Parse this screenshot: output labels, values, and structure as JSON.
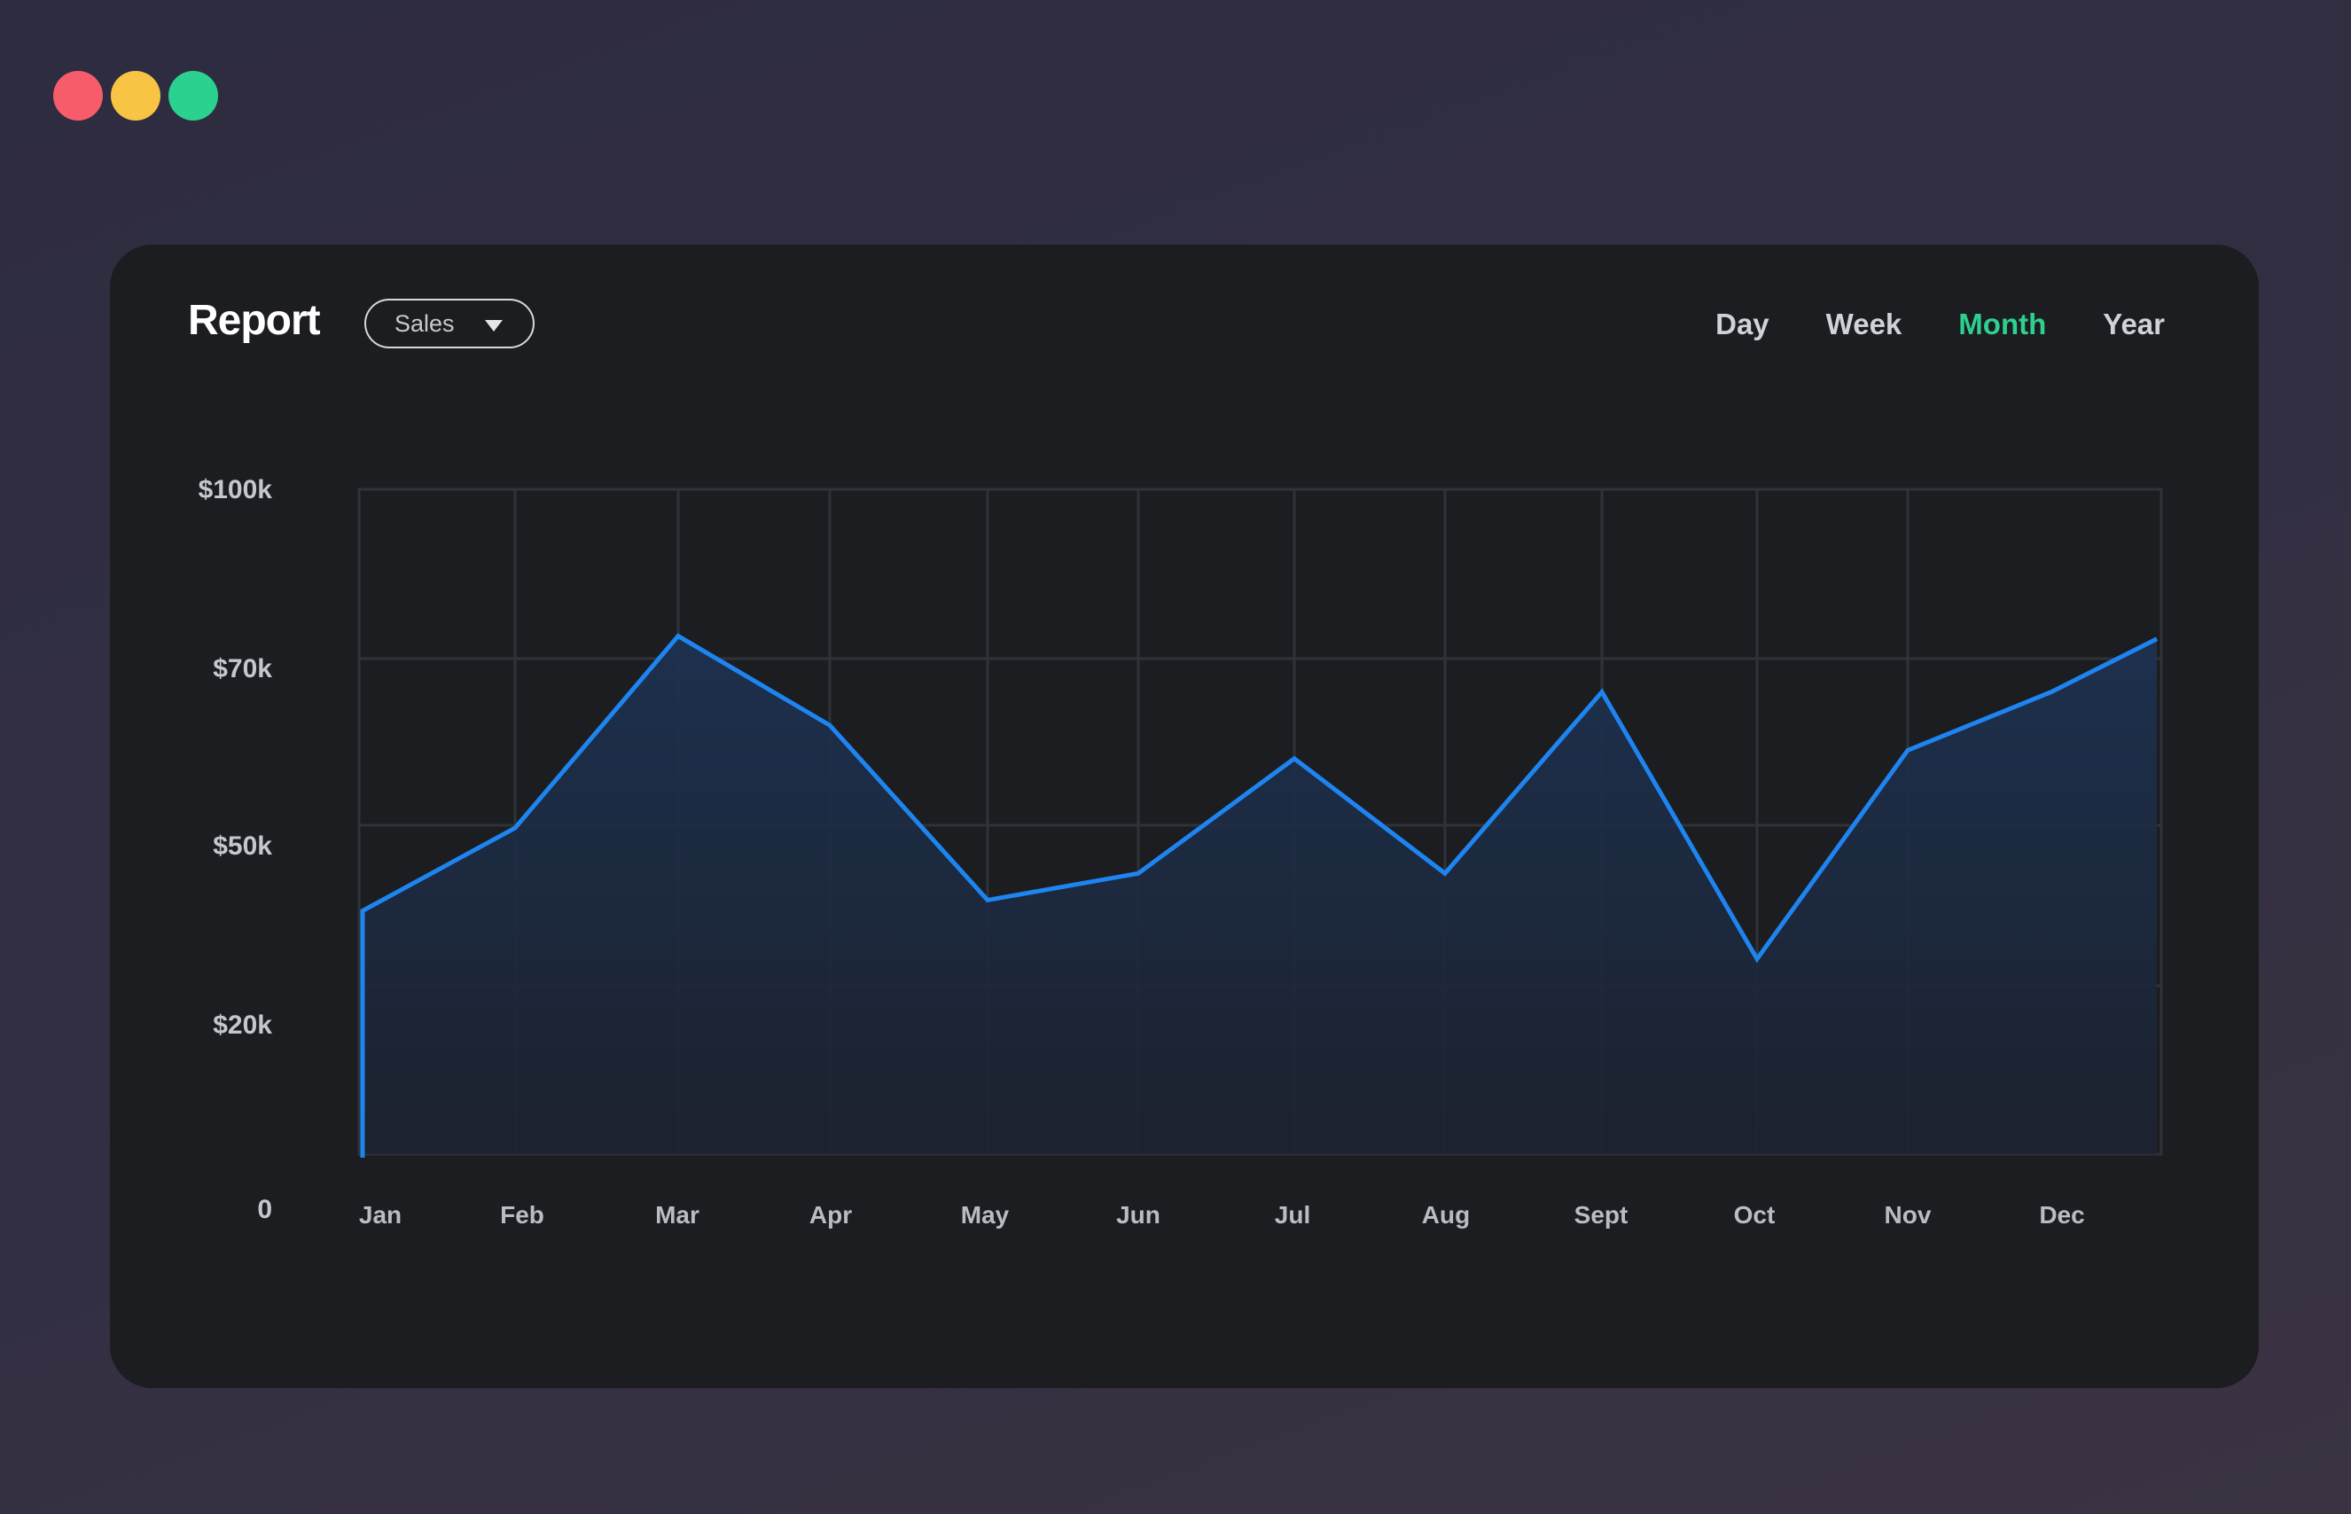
{
  "window": {
    "controls": [
      "close",
      "minimize",
      "maximize"
    ]
  },
  "header": {
    "title": "Report",
    "metric_dropdown": {
      "selected": "Sales",
      "icon": "chevron-down-icon"
    },
    "period_tabs": [
      {
        "label": "Day",
        "active": false
      },
      {
        "label": "Week",
        "active": false
      },
      {
        "label": "Month",
        "active": true
      },
      {
        "label": "Year",
        "active": false
      }
    ]
  },
  "colors": {
    "accent": "#2fcf8e",
    "line": "#1e84f0",
    "card": "#1b1d20",
    "close": "#f65c6a",
    "minimize": "#f8c443",
    "maximize": "#2bd18f"
  },
  "chart_data": {
    "type": "area",
    "title": "",
    "xlabel": "",
    "ylabel": "",
    "categories": [
      "Jan",
      "Feb",
      "Mar",
      "Apr",
      "May",
      "Jun",
      "Jul",
      "Aug",
      "Sept",
      "Oct",
      "Nov",
      "Dec"
    ],
    "y_tick_labels": [
      "$100k",
      "$70k",
      "$50k",
      "$20k",
      "0"
    ],
    "y_ticks": [
      100000,
      70000,
      50000,
      20000,
      0
    ],
    "ylim": [
      0,
      100000
    ],
    "grid": true,
    "series": [
      {
        "x": [
          "Jan",
          "Feb",
          "Mar",
          "Apr",
          "May",
          "Jun",
          "Jul",
          "Aug",
          "Sept",
          "Oct",
          "Nov",
          "Dec",
          "Dec"
        ],
        "values": [
          34000,
          49500,
          74000,
          62000,
          36000,
          41000,
          58000,
          41000,
          66000,
          25000,
          59000,
          66000,
          73500
        ]
      }
    ]
  }
}
